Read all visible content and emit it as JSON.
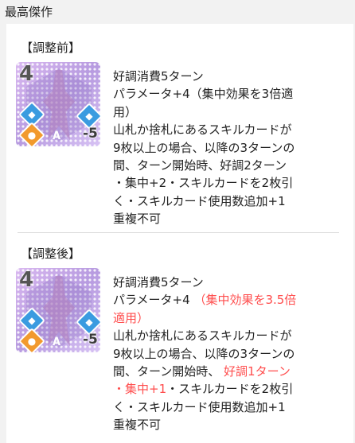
{
  "header": {
    "title": "最高傑作"
  },
  "before": {
    "title": "【調整前】",
    "card": {
      "cost": "4",
      "penalty": "-5",
      "rarity": "A"
    },
    "lines": [
      [
        {
          "text": "好調消費5ターン"
        }
      ],
      [
        {
          "text": "パラメータ+4（集中効果を3倍適"
        }
      ],
      [
        {
          "text": "用）"
        }
      ],
      [
        {
          "text": "山札か捨札にあるスキルカードが"
        }
      ],
      [
        {
          "text": "9枚以上の場合、以降の3ターンの"
        }
      ],
      [
        {
          "text": "間、ターン開始時、好調2ターン"
        }
      ],
      [
        {
          "text": "・集中+2・スキルカードを2枚引"
        }
      ],
      [
        {
          "text": "く・スキルカード使用数追加+1"
        }
      ],
      [
        {
          "text": "重複不可"
        }
      ]
    ]
  },
  "after": {
    "title": "【調整後】",
    "card": {
      "cost": "4",
      "penalty": "-5",
      "rarity": "A"
    },
    "lines": [
      [
        {
          "text": "好調消費5ターン"
        }
      ],
      [
        {
          "text": "パラメータ+4 "
        },
        {
          "text": "（集中効果を3.5倍",
          "highlight": true
        }
      ],
      [
        {
          "text": "適用）",
          "highlight": true
        }
      ],
      [
        {
          "text": "山札か捨札にあるスキルカードが"
        }
      ],
      [
        {
          "text": "9枚以上の場合、以降の3ターンの"
        }
      ],
      [
        {
          "text": "間、ターン開始時、 "
        },
        {
          "text": "好調1ターン",
          "highlight": true
        }
      ],
      [
        {
          "text": "・集中+1",
          "highlight": true
        },
        {
          "text": "・スキルカードを2枚引"
        }
      ],
      [
        {
          "text": "く・スキルカード使用数追加+1"
        }
      ],
      [
        {
          "text": "重複不可"
        }
      ]
    ]
  },
  "colors": {
    "highlight": "#ff4d4d",
    "background": "#f2f2f2",
    "panel": "#ffffff"
  },
  "icons": [
    "card-art",
    "concentration-icon",
    "good-condition-icon",
    "skill-icon"
  ]
}
